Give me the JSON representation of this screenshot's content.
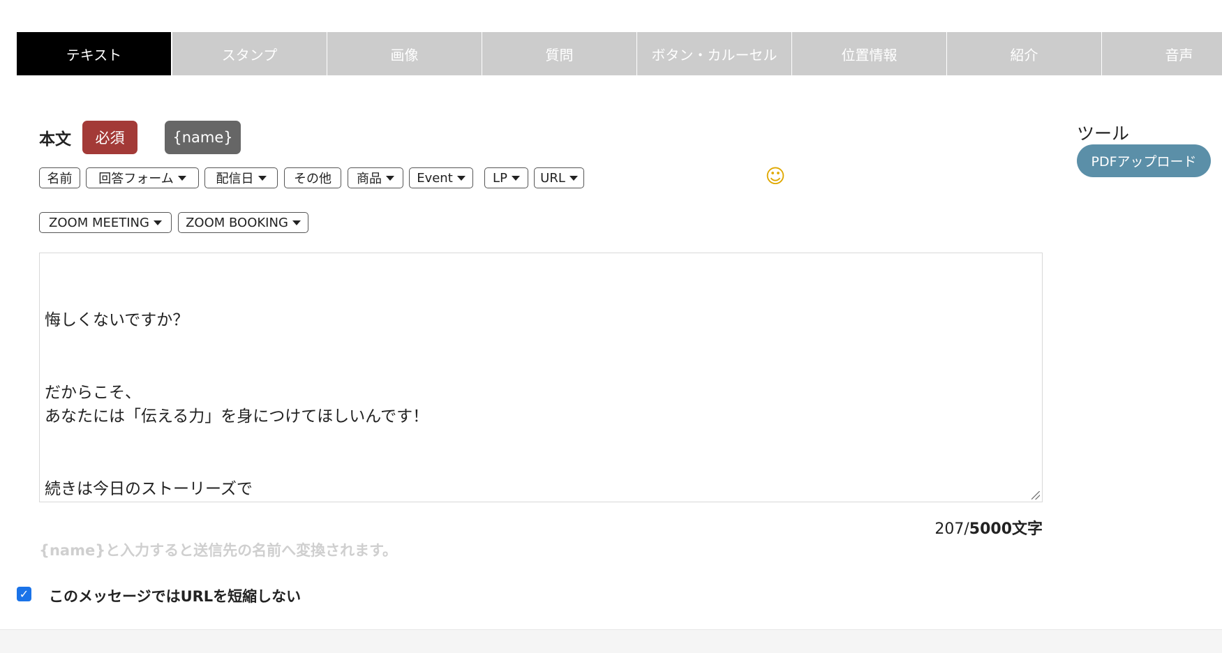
{
  "tabs": [
    {
      "label": "テキスト",
      "active": true
    },
    {
      "label": "スタンプ",
      "active": false
    },
    {
      "label": "画像",
      "active": false
    },
    {
      "label": "質問",
      "active": false
    },
    {
      "label": "ボタン・カルーセル",
      "active": false
    },
    {
      "label": "位置情報",
      "active": false
    },
    {
      "label": "紹介",
      "active": false
    },
    {
      "label": "音声",
      "active": false
    }
  ],
  "form": {
    "body_label": "本文",
    "required_badge": "必須",
    "name_button": "{name}"
  },
  "tools": {
    "label": "ツール",
    "pdf_button": "PDFアップロード"
  },
  "toolbar": {
    "name": "名前",
    "answer_form": "回答フォーム",
    "delivery_date": "配信日",
    "other": "その他",
    "product": "商品",
    "event": "Event",
    "lp": "LP",
    "url": "URL",
    "zoom_meeting": "ZOOM MEETING",
    "zoom_booking": "ZOOM BOOKING",
    "emoji_icon": "smiley-emoji-icon"
  },
  "message": {
    "text": "悔しくないですか？\n\n\nだからこそ、\nあなたには「伝える力」を身につけてほしいんです！\n\n\n続きは今日のストーリーズで\n↓↓\nhttps://www.instagram.com/tomoe.counseling",
    "count": "207/",
    "max": "5000文字"
  },
  "hint": "{name}と入力すると送信先の名前へ変換されます。",
  "options": {
    "no_shorten_url_label": "このメッセージではURLを短縮しない",
    "no_shorten_url_checked": true
  },
  "colors": {
    "active_tab": "#000000",
    "inactive_tab": "#cccccc",
    "required": "#a33a37",
    "name_button": "#666666",
    "pdf_button": "#5b8fa8",
    "checkbox": "#1a73e8"
  }
}
